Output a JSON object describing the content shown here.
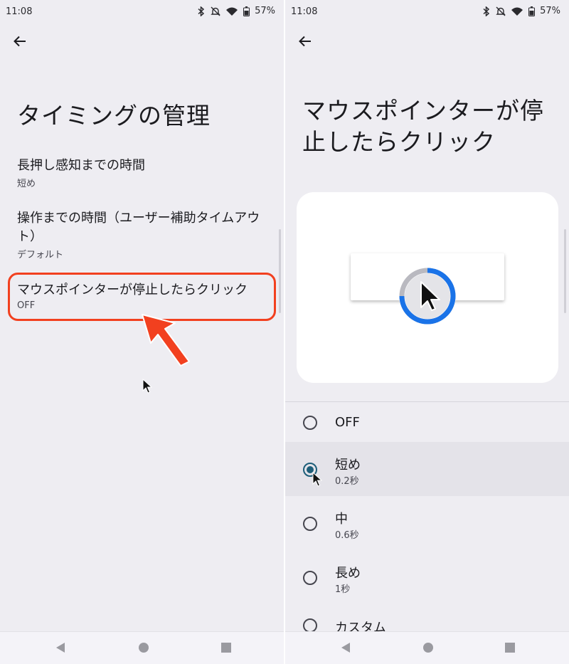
{
  "status": {
    "time": "11:08",
    "battery": "57%"
  },
  "left": {
    "title": "タイミングの管理",
    "items": [
      {
        "title": "長押し感知までの時間",
        "summary": "短め"
      },
      {
        "title": "操作までの時間（ユーザー補助タイムアウト）",
        "summary": "デフォルト"
      },
      {
        "title": "マウスポインターが停止したらクリック",
        "summary": "OFF"
      }
    ]
  },
  "right": {
    "title": "マウスポインターが停止したらクリック",
    "options": [
      {
        "label": "OFF",
        "sub": ""
      },
      {
        "label": "短め",
        "sub": "0.2秒"
      },
      {
        "label": "中",
        "sub": "0.6秒"
      },
      {
        "label": "長め",
        "sub": "1秒"
      },
      {
        "label": "カスタム",
        "sub": ""
      }
    ],
    "selected": "短め"
  },
  "colors": {
    "highlight": "#f2401f",
    "radio_selected": "#1d5e79",
    "ring_progress": "#1a73e8"
  },
  "icons": [
    "back-arrow-icon",
    "bluetooth-icon",
    "notifications-off-icon",
    "wifi-icon",
    "battery-icon",
    "nav-back-icon",
    "nav-home-icon",
    "nav-recents-icon",
    "mouse-pointer-icon",
    "red-arrow-annotation"
  ]
}
